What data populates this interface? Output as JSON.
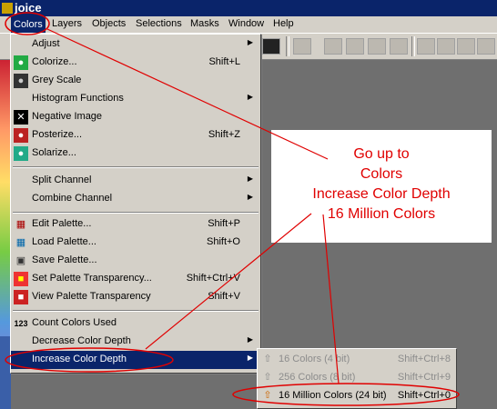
{
  "app": {
    "title": "joice"
  },
  "menubar": [
    "Colors",
    "Layers",
    "Objects",
    "Selections",
    "Masks",
    "Window",
    "Help"
  ],
  "colors_menu": [
    {
      "label": "Adjust",
      "shortcut": "",
      "submenu": true,
      "icon": ""
    },
    {
      "label": "Colorize...",
      "shortcut": "Shift+L",
      "submenu": false,
      "icon": "colorize-icon"
    },
    {
      "label": "Grey Scale",
      "shortcut": "",
      "submenu": false,
      "icon": "greyscale-icon"
    },
    {
      "label": "Histogram Functions",
      "shortcut": "",
      "submenu": true,
      "icon": ""
    },
    {
      "label": "Negative Image",
      "shortcut": "",
      "submenu": false,
      "icon": "negative-icon"
    },
    {
      "label": "Posterize...",
      "shortcut": "Shift+Z",
      "submenu": false,
      "icon": "posterize-icon"
    },
    {
      "label": "Solarize...",
      "shortcut": "",
      "submenu": false,
      "icon": "solarize-icon"
    },
    {
      "label": "Split Channel",
      "shortcut": "",
      "submenu": true,
      "icon": ""
    },
    {
      "label": "Combine Channel",
      "shortcut": "",
      "submenu": true,
      "icon": ""
    },
    {
      "label": "Edit Palette...",
      "shortcut": "Shift+P",
      "submenu": false,
      "icon": "edit-palette-icon"
    },
    {
      "label": "Load Palette...",
      "shortcut": "Shift+O",
      "submenu": false,
      "icon": "load-palette-icon"
    },
    {
      "label": "Save Palette...",
      "shortcut": "",
      "submenu": false,
      "icon": "save-palette-icon"
    },
    {
      "label": "Set Palette Transparency...",
      "shortcut": "Shift+Ctrl+V",
      "submenu": false,
      "icon": "set-transparency-icon"
    },
    {
      "label": "View Palette Transparency",
      "shortcut": "Shift+V",
      "submenu": false,
      "icon": "view-transparency-icon"
    },
    {
      "label": "Count Colors Used",
      "shortcut": "",
      "submenu": false,
      "icon": "count-colors-icon"
    },
    {
      "label": "Decrease Color Depth",
      "shortcut": "",
      "submenu": true,
      "icon": ""
    },
    {
      "label": "Increase Color Depth",
      "shortcut": "",
      "submenu": true,
      "icon": ""
    }
  ],
  "increase_submenu": [
    {
      "label": "16 Colors (4 bit)",
      "shortcut": "Shift+Ctrl+8",
      "enabled": false
    },
    {
      "label": "256 Colors (8 bit)",
      "shortcut": "Shift+Ctrl+9",
      "enabled": false
    },
    {
      "label": "16 Million Colors (24 bit)",
      "shortcut": "Shift+Ctrl+0",
      "enabled": true
    }
  ],
  "callout": [
    "Go up to",
    "Colors",
    "Increase Color Depth",
    "16 Million Colors"
  ],
  "colors": {
    "menu_bg": "#d4d0c8",
    "highlight": "#0a246a",
    "annotation": "#e00000"
  }
}
